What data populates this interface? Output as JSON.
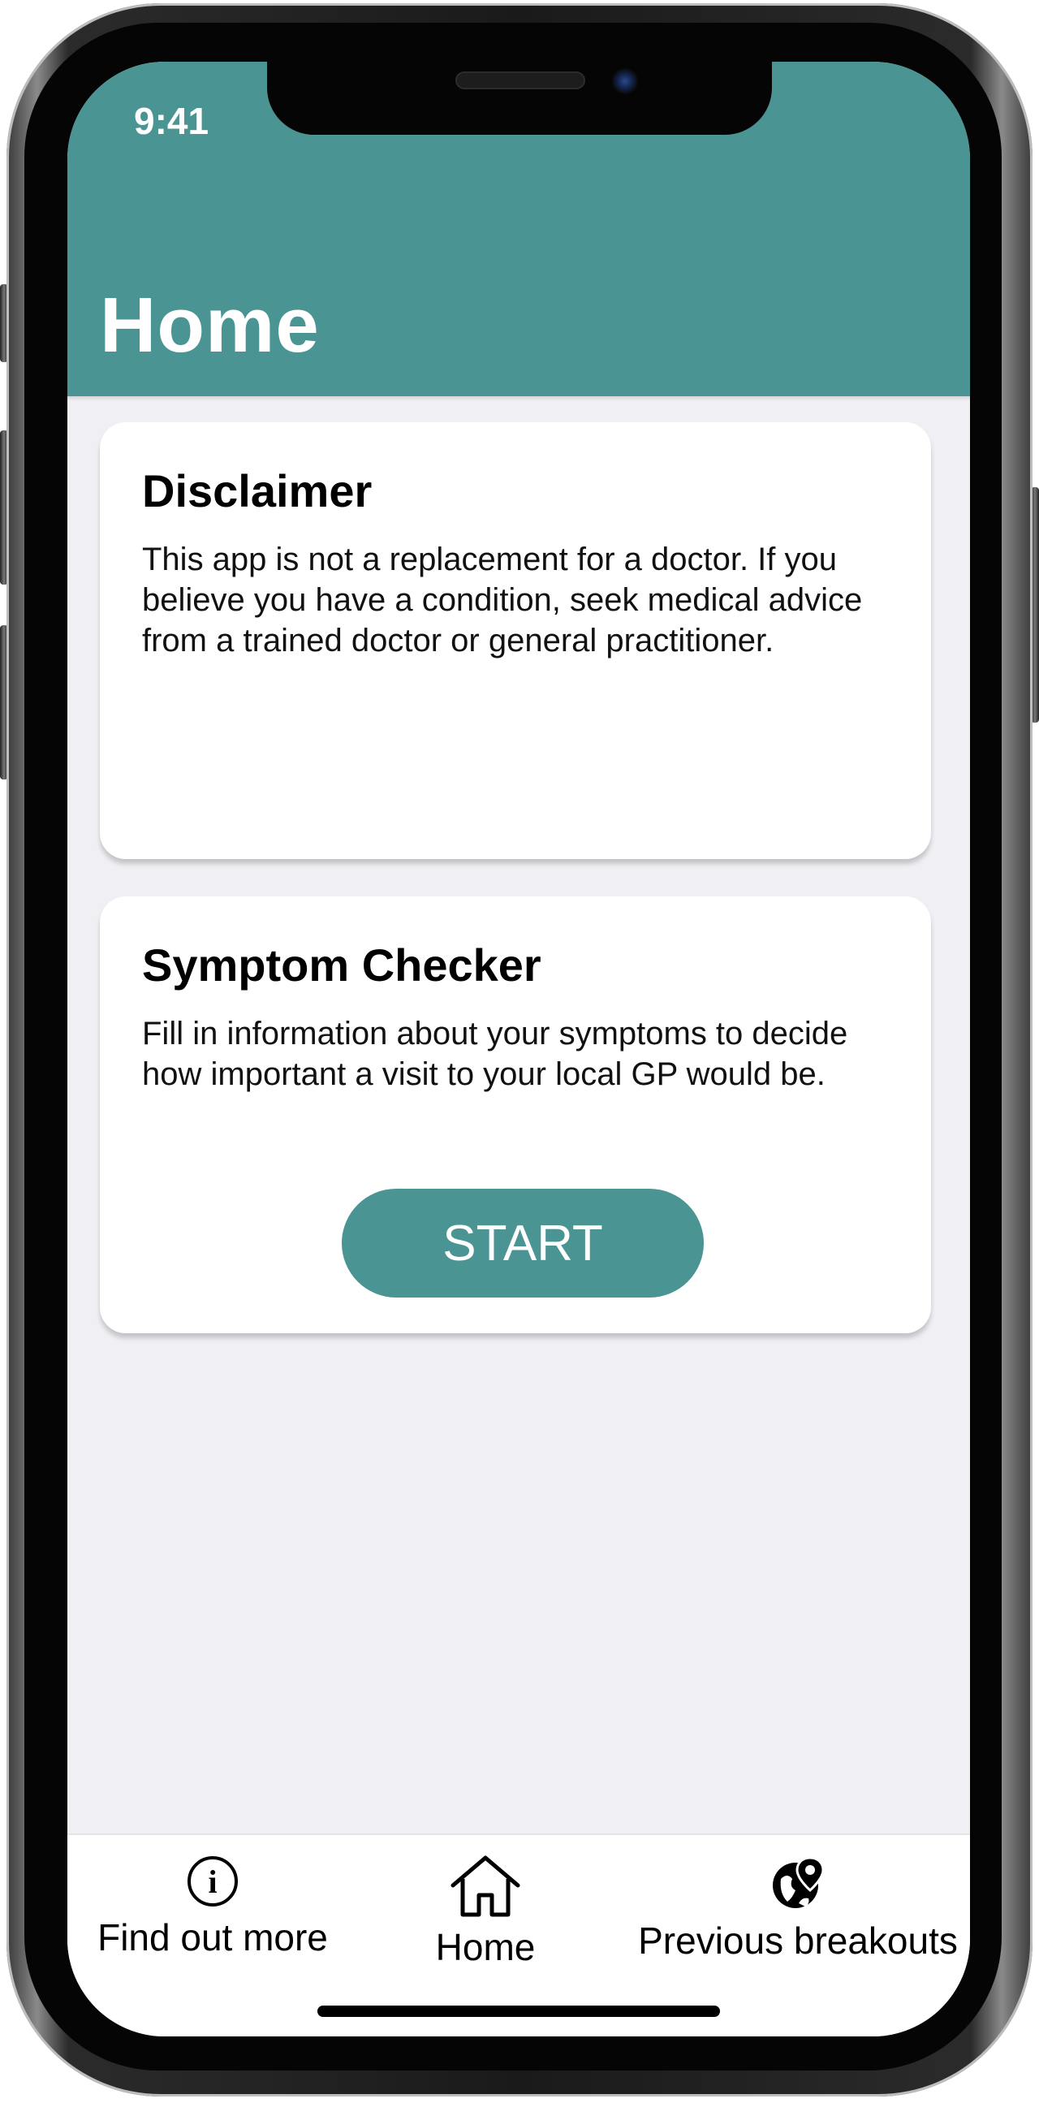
{
  "status_bar": {
    "time": "9:41"
  },
  "header": {
    "title": "Home"
  },
  "cards": {
    "disclaimer": {
      "title": "Disclaimer",
      "text": "This app is not a replacement for a doctor. If you believe you have a condition, seek medical advice from a trained doctor or general practitioner."
    },
    "symptom_checker": {
      "title": "Symptom Checker",
      "text": "Fill in information about your symptoms to decide how important a visit to your local GP would be.",
      "button_label": "START"
    }
  },
  "tab_bar": {
    "items": [
      {
        "label": "Find out more",
        "icon": "info-icon"
      },
      {
        "label": "Home",
        "icon": "home-icon"
      },
      {
        "label": "Previous breakouts",
        "icon": "globe-pin-icon"
      }
    ]
  },
  "colors": {
    "accent": "#4a9494",
    "background": "#f0f0f4",
    "card": "#ffffff"
  }
}
